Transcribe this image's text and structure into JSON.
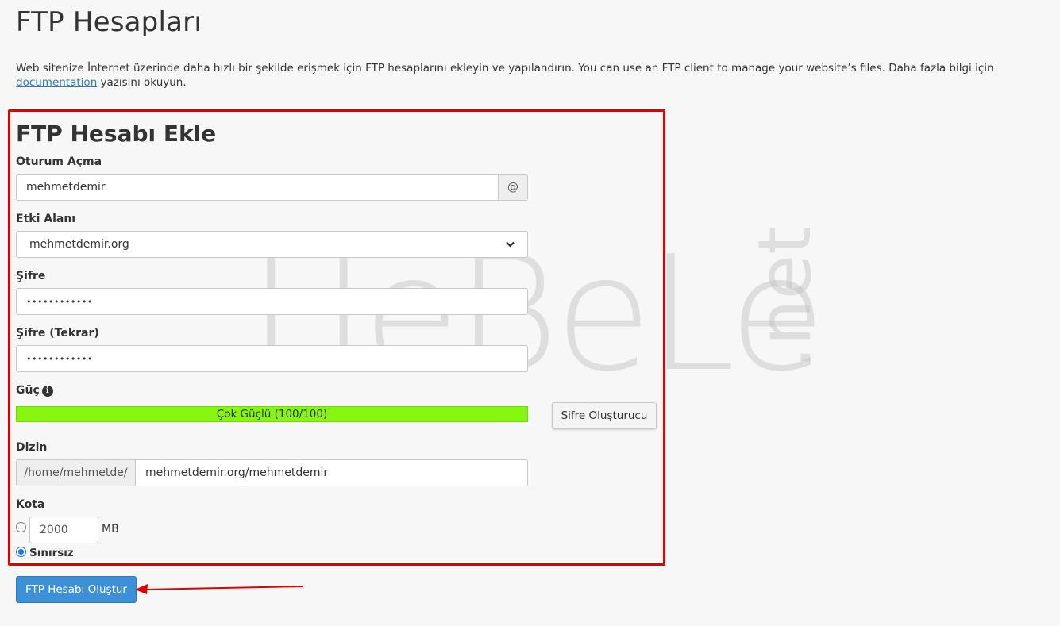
{
  "page": {
    "title": "FTP Hesapları",
    "intro_text": "Web sitenize İnternet üzerinde daha hızlı bir şekilde erişmek için FTP hesaplarını ekleyin ve yapılandırın. You can use an FTP client to manage your website’s files. Daha fazla bilgi için ",
    "intro_link": "documentation",
    "intro_tail": "yazısını okuyun."
  },
  "watermark": {
    "main": "HeBeLe",
    "tld": ".net"
  },
  "form": {
    "title": "FTP Hesabı Ekle",
    "login": {
      "label": "Oturum Açma",
      "value": "mehmetdemir",
      "addon": "@"
    },
    "domain": {
      "label": "Etki Alanı",
      "selected": "mehmetdemir.org"
    },
    "password": {
      "label": "Şifre",
      "value": "••••••••••••"
    },
    "password_repeat": {
      "label": "Şifre (Tekrar)",
      "value": "••••••••••••"
    },
    "strength": {
      "label": "Güç",
      "text": "Çok Güçlü (100/100)",
      "score": 100,
      "color": "#86f60e"
    },
    "generator_button": "Şifre Oluşturucu",
    "directory": {
      "label": "Dizin",
      "prefix": "/home/mehmetde/",
      "value": "mehmetdemir.org/mehmetdemir"
    },
    "quota": {
      "label": "Kota",
      "value": "2000",
      "unit": "MB",
      "unlimited_label": "Sınırsız",
      "unlimited_selected": true
    }
  },
  "submit_button": "FTP Hesabı Oluştur",
  "colors": {
    "highlight": "#e00000",
    "primary": "#3d8fd6",
    "link": "#337ab7"
  }
}
